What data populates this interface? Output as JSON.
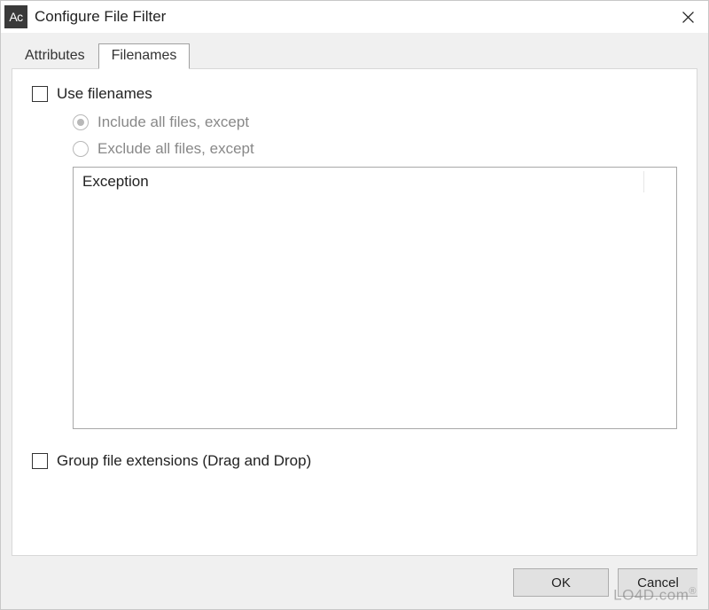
{
  "window": {
    "app_icon_text": "Ac",
    "title": "Configure File Filter"
  },
  "tabs": {
    "attributes": "Attributes",
    "filenames": "Filenames"
  },
  "content": {
    "use_filenames": "Use filenames",
    "include_label": "Include all files, except",
    "exclude_label": "Exclude all files, except",
    "list_header": "Exception",
    "group_ext": "Group file extensions (Drag and Drop)"
  },
  "buttons": {
    "ok": "OK",
    "cancel": "Cancel"
  },
  "watermark": "LO4D.com"
}
